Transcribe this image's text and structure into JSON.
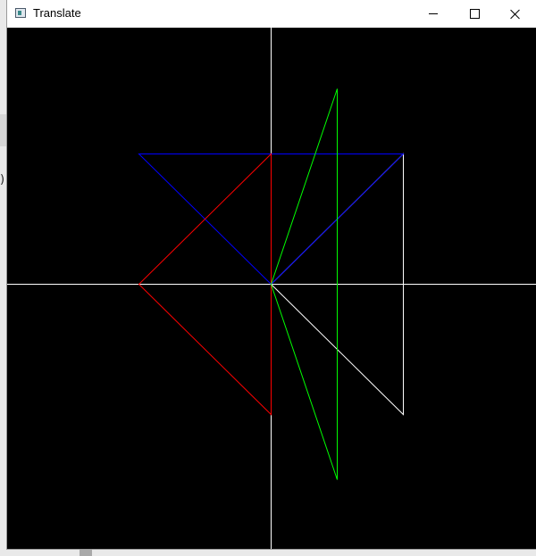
{
  "window": {
    "title": "Translate",
    "app_icon": "opengl-app-icon"
  },
  "titlebar_controls": {
    "minimize_icon": "minimize-icon",
    "maximize_icon": "maximize-icon",
    "close_icon": "close-icon"
  },
  "backdrop": {
    "paren_text": ")"
  },
  "canvas": {
    "background": "#000000",
    "scene": {
      "units_per_half_extent": 2,
      "axes": {
        "color": "#ffffff"
      },
      "triangles": [
        {
          "id": "white-triangle",
          "color": "#ffffff",
          "points": [
            [
              0,
              0
            ],
            [
              1,
              1
            ],
            [
              1,
              -1
            ]
          ]
        },
        {
          "id": "blue-triangle",
          "color": "#0000ff",
          "points": [
            [
              0,
              0
            ],
            [
              -1,
              1
            ],
            [
              1,
              1
            ]
          ]
        },
        {
          "id": "red-triangle",
          "color": "#ff0000",
          "points": [
            [
              0,
              0
            ],
            [
              0,
              1
            ],
            [
              -1,
              0
            ],
            [
              0,
              -1
            ]
          ]
        },
        {
          "id": "green-triangle",
          "color": "#00ff00",
          "points": [
            [
              0,
              0
            ],
            [
              0.5,
              1.5
            ],
            [
              0.5,
              -1.5
            ]
          ]
        }
      ]
    }
  }
}
